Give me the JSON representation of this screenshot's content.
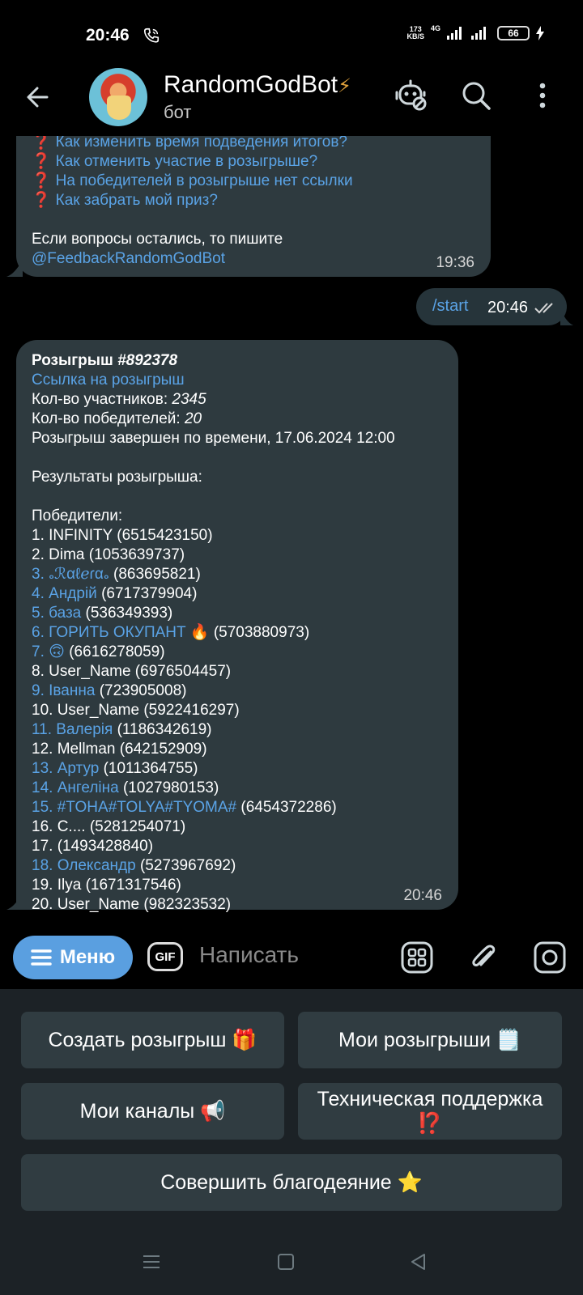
{
  "status": {
    "time": "20:46",
    "speed_value": "173",
    "speed_unit": "KB/S",
    "network": "4G",
    "battery": "66"
  },
  "header": {
    "title": "RandomGodBot",
    "title_suffix": "⚡",
    "subtitle": "бот"
  },
  "earlier_message": {
    "items": [
      "Как изменить время подведения итогов?",
      "Как отменить участие в розыгрыше?",
      "На победителей в розыгрыше нет ссылки",
      "Как забрать мой приз?"
    ],
    "contact_text": "Если вопросы остались, то пишите",
    "contact_link": "@FeedbackRandomGodBot",
    "time": "19:36"
  },
  "outgoing": {
    "text": "/start",
    "time": "20:46"
  },
  "giveaway": {
    "title_prefix": "Розыгрыш ",
    "title_id": "#892378",
    "link_text": "Ссылка на розыгрыш",
    "participants_label": "Кол-во участников: ",
    "participants": "2345",
    "winners_label": "Кол-во победителей: ",
    "winners_count": "20",
    "finished": "Розыгрыш завершен по времени, 17.06.2024 12:00",
    "results_heading": "Результаты розыгрыша:",
    "winners_heading": "Победители:",
    "winners": [
      {
        "num": "1.",
        "name": "INFINITY",
        "id": "(6515423150)",
        "link": false
      },
      {
        "num": "2.",
        "name": "Dima",
        "id": "(1053639737)",
        "link": false
      },
      {
        "num": "3.",
        "name": "૰ℛαℓℯɾα૰",
        "id": "(863695821)",
        "link": true
      },
      {
        "num": "4.",
        "name": "Андрій",
        "id": "(6717379904)",
        "link": true
      },
      {
        "num": "5.",
        "name": "база",
        "id": "(536349393)",
        "link": true
      },
      {
        "num": "6.",
        "name": "ГОРИТЬ ОКУПАНТ 🔥",
        "id": "(5703880973)",
        "link": true
      },
      {
        "num": "7.",
        "name": "🙃",
        "id": "(6616278059)",
        "link": true
      },
      {
        "num": "8.",
        "name": "User_Name",
        "id": "(6976504457)",
        "link": false
      },
      {
        "num": "9.",
        "name": "Іванна",
        "id": "(723905008)",
        "link": true
      },
      {
        "num": "10.",
        "name": "User_Name",
        "id": "(5922416297)",
        "link": false
      },
      {
        "num": "11.",
        "name": "Валерія",
        "id": "(1186342619)",
        "link": true
      },
      {
        "num": "12.",
        "name": "Mellman",
        "id": "(642152909)",
        "link": false
      },
      {
        "num": "13.",
        "name": "Артур",
        "id": "(1011364755)",
        "link": true
      },
      {
        "num": "14.",
        "name": "Ангеліна",
        "id": "(1027980153)",
        "link": true
      },
      {
        "num": "15.",
        "name": "#TOHA#TOLYA#TYOMA#",
        "id": "(6454372286)",
        "link": true
      },
      {
        "num": "16.",
        "name": "C....",
        "id": "(5281254071)",
        "link": false
      },
      {
        "num": "17.",
        "name": "",
        "id": "(1493428840)",
        "link": false
      },
      {
        "num": "18.",
        "name": "Олександр",
        "id": "(5273967692)",
        "link": true
      },
      {
        "num": "19.",
        "name": "Ilya",
        "id": "(1671317546)",
        "link": false
      },
      {
        "num": "20.",
        "name": "User_Name",
        "id": "(982323532)",
        "link": false
      }
    ],
    "time": "20:46"
  },
  "composer": {
    "menu_label": "Меню",
    "gif_label": "GIF",
    "placeholder": "Написать"
  },
  "keyboard": {
    "create": "Создать розыгрыш 🎁",
    "my_giveaways": "Мои розыгрыши 🗒️",
    "my_channels": "Мои каналы 📢",
    "support_line1": "Техническая поддержка",
    "support_line2": "⁉️",
    "good_deed": "Совершить благодеяние ⭐"
  },
  "colors": {
    "link": "#5aa3e6",
    "bubble": "#2e3a3f",
    "accent": "#5a9fe0",
    "keyboard_bg": "#1c2226"
  }
}
